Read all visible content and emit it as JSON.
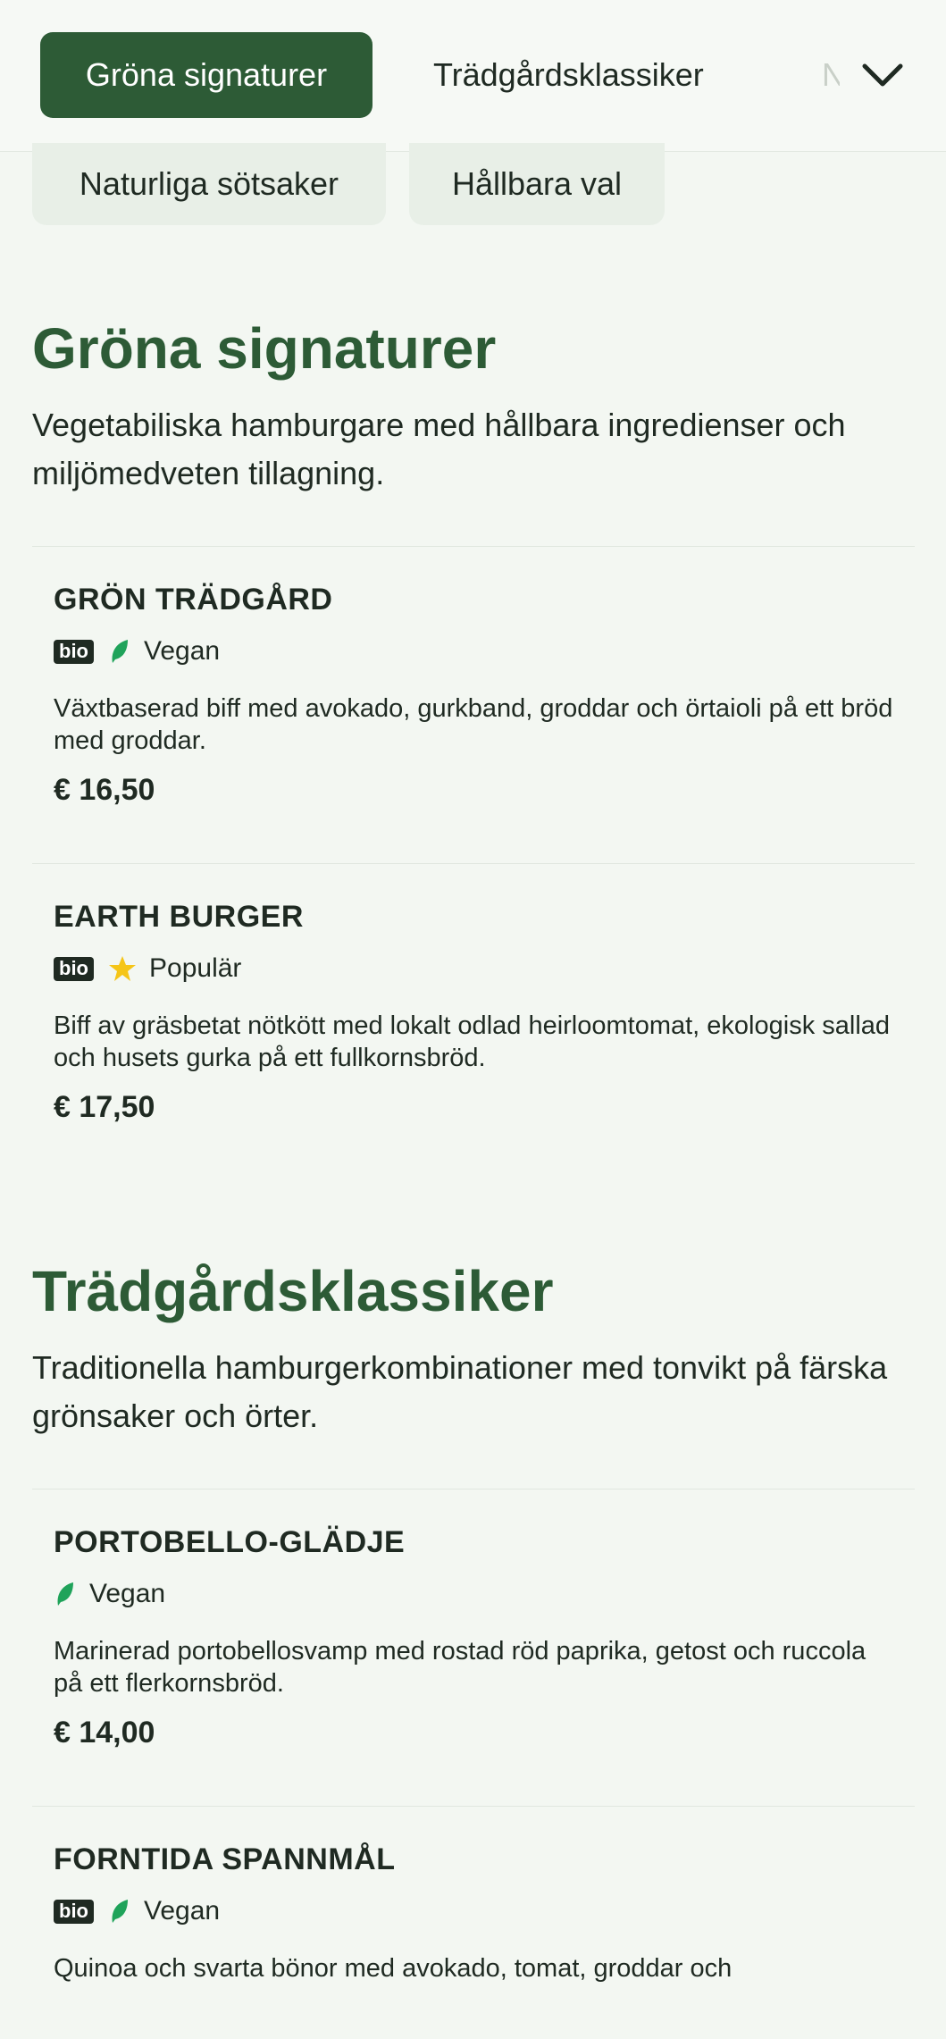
{
  "topbar": {
    "tabs": [
      {
        "label": "Gröna signaturer"
      },
      {
        "label": "Trädgårdsklassiker"
      },
      {
        "label": "N"
      }
    ]
  },
  "chips": [
    {
      "label": "Naturliga sötsaker"
    },
    {
      "label": "Hållbara val"
    }
  ],
  "sections": [
    {
      "title": "Gröna signaturer",
      "description": "Vegetabiliska hamburgare med hållbara ingredienser och miljömedveten tillagning.",
      "items": [
        {
          "name": "GRÖN TRÄDGÅRD",
          "badge": "bio",
          "tag": "Vegan",
          "tag_icon": "leaf-icon",
          "description": "Växtbaserad biff med avokado, gurkband, groddar och örtaioli på ett bröd med groddar.",
          "price": "€ 16,50"
        },
        {
          "name": "EARTH BURGER",
          "badge": "bio",
          "tag": "Populär",
          "tag_icon": "star-icon",
          "description": "Biff av gräsbetat nötkött med lokalt odlad heirloomtomat, ekologisk sallad och husets gurka på ett fullkornsbröd.",
          "price": "€ 17,50"
        }
      ]
    },
    {
      "title": "Trädgårdsklassiker",
      "description": "Traditionella hamburgerkombinationer med tonvikt på färska grönsaker och örter.",
      "items": [
        {
          "name": "PORTOBELLO-GLÄDJE",
          "tag": "Vegan",
          "tag_icon": "leaf-icon",
          "description": "Marinerad portobellosvamp med rostad röd paprika, getost och ruccola på ett flerkornsbröd.",
          "price": "€ 14,00"
        },
        {
          "name": "FORNTIDA SPANNMÅL",
          "badge": "bio",
          "tag": "Vegan",
          "tag_icon": "leaf-icon",
          "description": "Quinoa och svarta bönor med avokado, tomat, groddar och"
        }
      ]
    }
  ],
  "colors": {
    "primary": "#2d5b36",
    "leaf": "#1fa35a",
    "star": "#f5c518",
    "background": "#f3f7f2"
  }
}
